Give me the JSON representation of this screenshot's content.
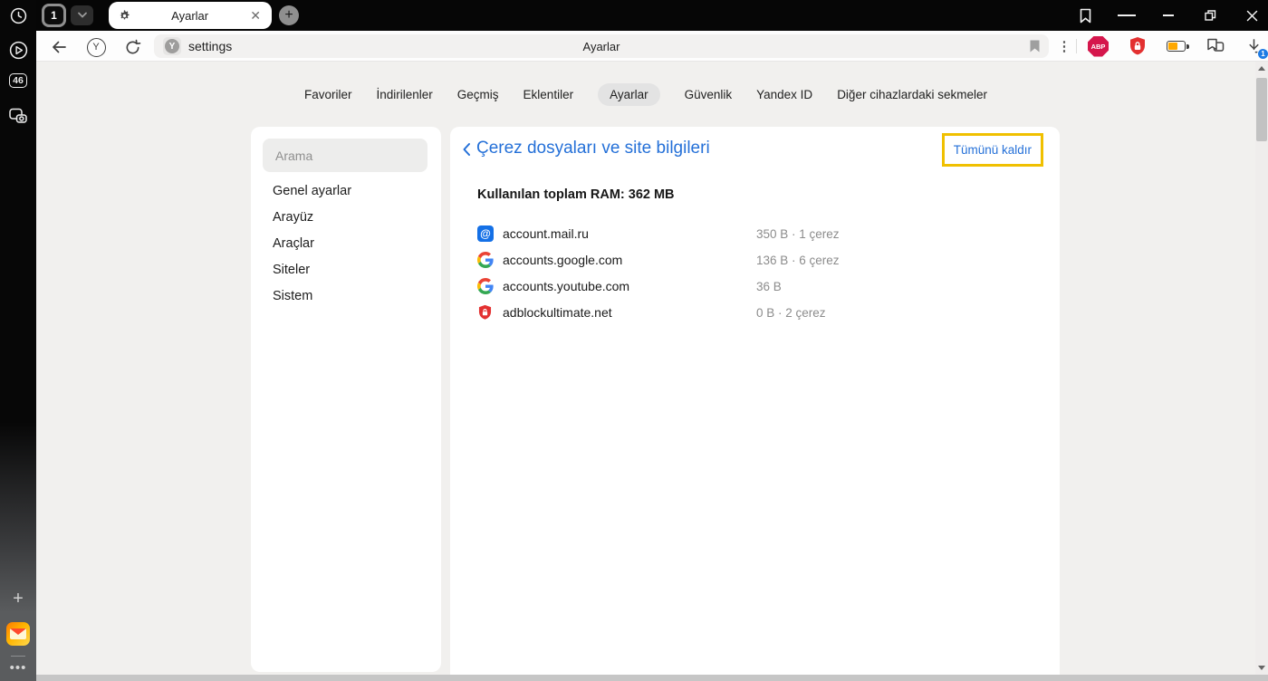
{
  "window": {
    "tab_count": "1",
    "tab_title": "Ayarlar",
    "new_tab_glyph": "+",
    "close_glyph": "✕"
  },
  "address_bar": {
    "url": "settings",
    "page_title": "Ayarlar",
    "favicon_letter": "Y",
    "browser_logo_letter": "Y",
    "kebab_glyph": "⋮",
    "abp_label": "ABP",
    "downloads_badge": "1"
  },
  "rail": {
    "tab_counter": "46",
    "plus_glyph": "+",
    "more_glyph": "•••"
  },
  "nav": {
    "items": [
      "Favoriler",
      "İndirilenler",
      "Geçmiş",
      "Eklentiler",
      "Ayarlar",
      "Güvenlik",
      "Yandex ID",
      "Diğer cihazlardaki sekmeler"
    ]
  },
  "settings_nav": {
    "search_placeholder": "Arama",
    "items": [
      "Genel ayarlar",
      "Arayüz",
      "Araçlar",
      "Siteler",
      "Sistem"
    ]
  },
  "content": {
    "title": "Çerez dosyaları ve site bilgileri",
    "remove_all_label": "Tümünü kaldır",
    "ram_line": "Kullanılan toplam RAM: 362 MB",
    "sites": [
      {
        "name": "account.mail.ru",
        "info": "350 B · 1 çerez",
        "icon": "mailru-at-icon"
      },
      {
        "name": "accounts.google.com",
        "info": "136 B · 6 çerez",
        "icon": "google-g-icon"
      },
      {
        "name": "accounts.youtube.com",
        "info": "36 B",
        "icon": "google-g-icon"
      },
      {
        "name": "adblockultimate.net",
        "info": "0 B · 2 çerez",
        "icon": "red-shield-lock-icon"
      }
    ],
    "mailru_glyph": "@"
  },
  "colors": {
    "accent_blue": "#2470d8",
    "highlight_gold": "#f0c000",
    "titlebar_black": "#060606",
    "page_bg": "#f1f0ee",
    "panel_white": "#ffffff",
    "active_pill": "#e3e3e3",
    "muted_text": "#8c8c8c"
  }
}
